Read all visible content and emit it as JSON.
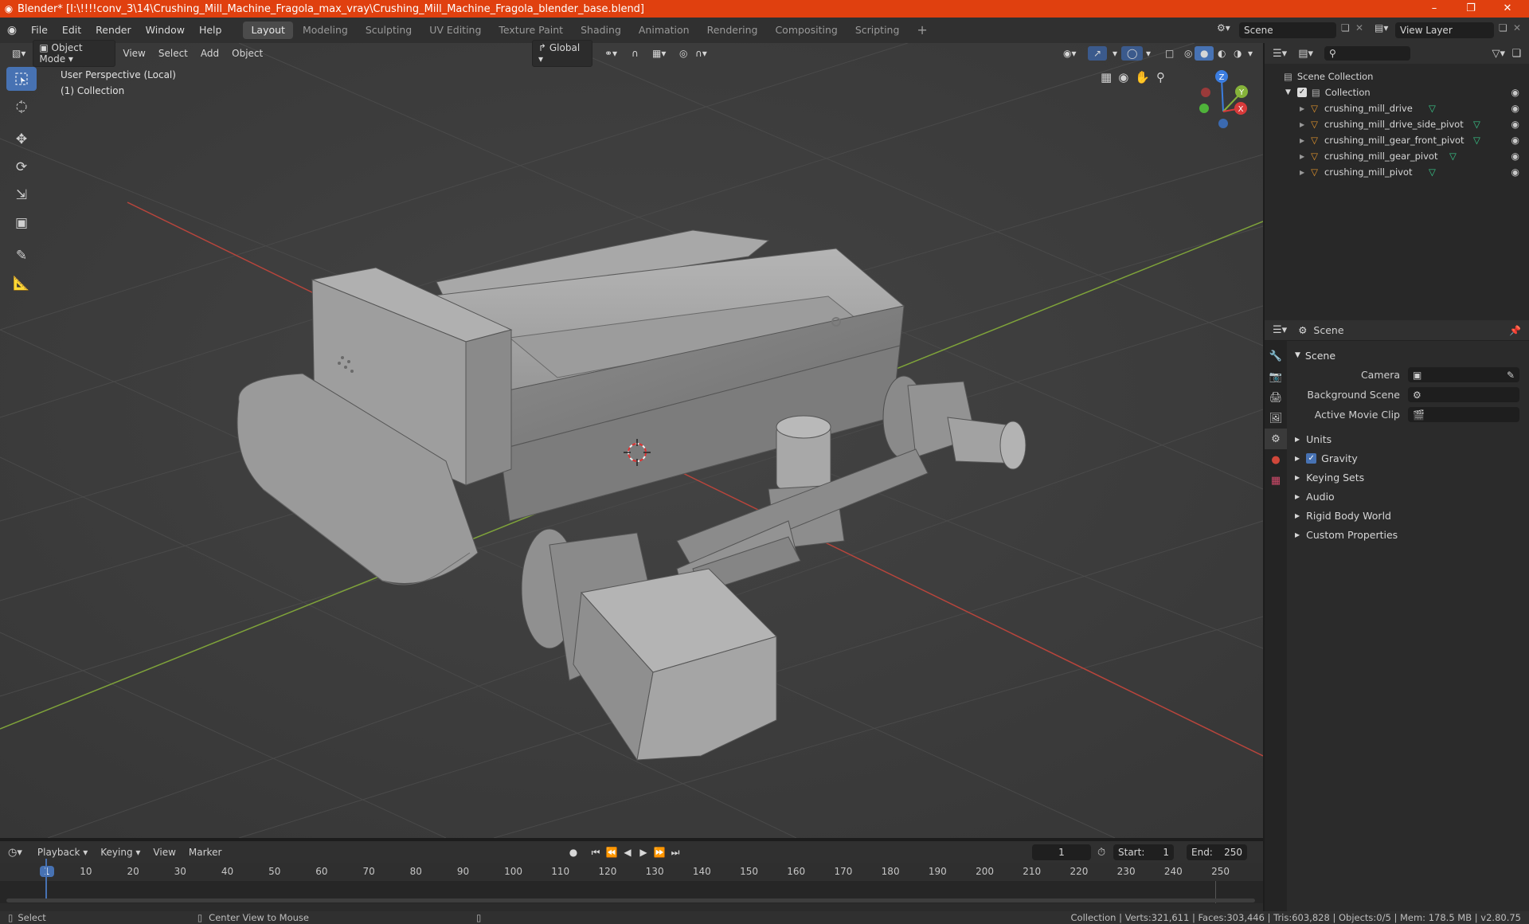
{
  "titlebar": {
    "title": "Blender* [I:\\!!!!conv_3\\14\\Crushing_Mill_Machine_Fragola_max_vray\\Crushing_Mill_Machine_Fragola_blender_base.blend]",
    "minimize": "–",
    "maximize": "❐",
    "close": "✕"
  },
  "menu": [
    "File",
    "Edit",
    "Render",
    "Window",
    "Help"
  ],
  "workspaces": [
    "Layout",
    "Modeling",
    "Sculpting",
    "UV Editing",
    "Texture Paint",
    "Shading",
    "Animation",
    "Rendering",
    "Compositing",
    "Scripting"
  ],
  "active_workspace": "Layout",
  "scene_field": "Scene",
  "view_layer_field": "View Layer",
  "viewport": {
    "mode": "Object Mode",
    "menus": [
      "View",
      "Select",
      "Add",
      "Object"
    ],
    "orientation": "Global",
    "info_line1": "User Perspective (Local)",
    "info_line2": "(1) Collection",
    "gizmo": {
      "x": "X",
      "y": "Y",
      "z": "Z"
    }
  },
  "outliner": {
    "root": "Scene Collection",
    "collection": "Collection",
    "objects": [
      "crushing_mill_drive",
      "crushing_mill_drive_side_pivot",
      "crushing_mill_gear_front_pivot",
      "crushing_mill_gear_pivot",
      "crushing_mill_pivot"
    ]
  },
  "properties": {
    "context": "Scene",
    "panel": "Scene",
    "camera_label": "Camera",
    "background_scene_label": "Background Scene",
    "active_movie_clip_label": "Active Movie Clip",
    "subpanels": [
      "Units",
      "Gravity",
      "Keying Sets",
      "Audio",
      "Rigid Body World",
      "Custom Properties"
    ],
    "gravity_checked": true
  },
  "timeline": {
    "menus": [
      "Playback",
      "Keying",
      "View",
      "Marker"
    ],
    "current_frame": "1",
    "start_label": "Start:",
    "start": "1",
    "end_label": "End:",
    "end": "250",
    "ticks": [
      "1",
      "10",
      "20",
      "30",
      "40",
      "50",
      "60",
      "70",
      "80",
      "90",
      "100",
      "110",
      "120",
      "130",
      "140",
      "150",
      "160",
      "170",
      "180",
      "190",
      "200",
      "210",
      "220",
      "230",
      "240",
      "250"
    ]
  },
  "statusbar": {
    "select": "Select",
    "center_view": "Center View to Mouse",
    "stats": "Collection | Verts:321,611 | Faces:303,446 | Tris:603,828 | Objects:0/5 | Mem: 178.5 MB | v2.80.75"
  },
  "colors": {
    "title_bg": "#e0400f",
    "accent": "#4772b3",
    "axis_x": "#d83a3a",
    "axis_y": "#86b33a",
    "axis_z": "#3b7de0",
    "mesh_icon": "#e0932c",
    "data_icon": "#38c78a"
  }
}
